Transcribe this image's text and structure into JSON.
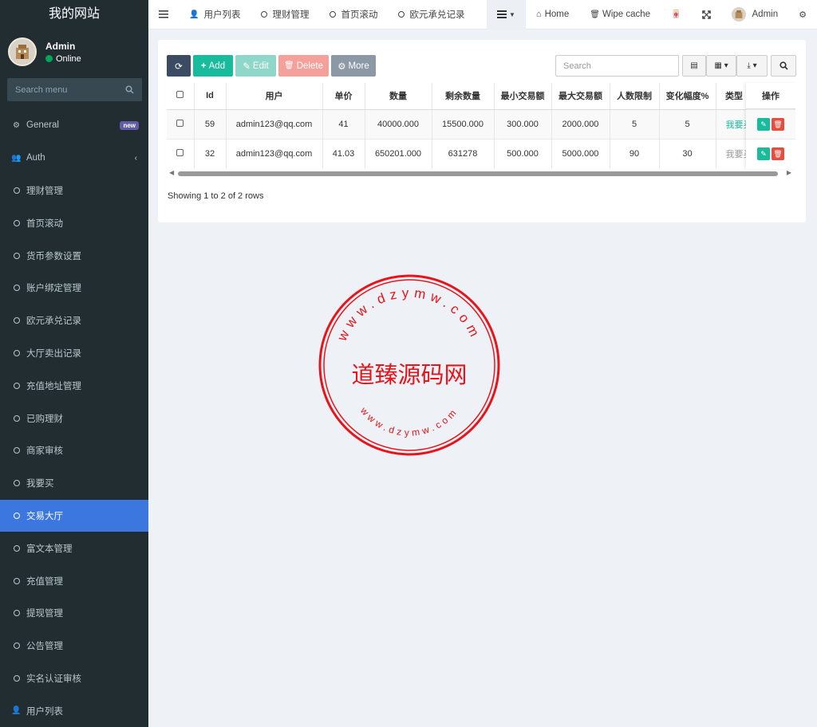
{
  "app": {
    "logo": "我的网站"
  },
  "user": {
    "name": "Admin",
    "status": "Online"
  },
  "sidebar": {
    "search_placeholder": "Search menu",
    "items": [
      {
        "label": "General",
        "icon": "gears-icon",
        "badge": "new"
      },
      {
        "label": "Auth",
        "icon": "users-icon",
        "chevron": "‹"
      },
      {
        "label": "理财管理",
        "icon": "circle-icon"
      },
      {
        "label": "首页滚动",
        "icon": "circle-icon"
      },
      {
        "label": "货币参数设置",
        "icon": "circle-icon"
      },
      {
        "label": "账户绑定管理",
        "icon": "circle-icon"
      },
      {
        "label": "欧元承兑记录",
        "icon": "circle-icon"
      },
      {
        "label": "大厅卖出记录",
        "icon": "circle-icon"
      },
      {
        "label": "充值地址管理",
        "icon": "circle-icon"
      },
      {
        "label": "已购理财",
        "icon": "circle-icon"
      },
      {
        "label": "商家审核",
        "icon": "circle-icon"
      },
      {
        "label": "我要买",
        "icon": "circle-icon"
      },
      {
        "label": "交易大厅",
        "icon": "circle-icon",
        "active": true
      },
      {
        "label": "富文本管理",
        "icon": "circle-icon"
      },
      {
        "label": "充值管理",
        "icon": "circle-icon"
      },
      {
        "label": "提现管理",
        "icon": "circle-icon"
      },
      {
        "label": "公告管理",
        "icon": "circle-icon"
      },
      {
        "label": "实名认证审核",
        "icon": "circle-icon"
      },
      {
        "label": "用户列表",
        "icon": "user-icon"
      }
    ]
  },
  "topbar": {
    "tabs": [
      "用户列表",
      "理财管理",
      "首页滚动",
      "欧元承兑记录"
    ],
    "home": "Home",
    "wipe_cache": "Wipe cache",
    "admin": "Admin"
  },
  "toolbar": {
    "add": "Add",
    "edit": "Edit",
    "delete": "Delete",
    "more": "More",
    "search_placeholder": "Search"
  },
  "table": {
    "headers": [
      "Id",
      "用户",
      "单价",
      "数量",
      "剩余数量",
      "最小交易额",
      "最大交易额",
      "人数限制",
      "变化幅度%",
      "类型",
      "操作"
    ],
    "rows": [
      {
        "id": "59",
        "user": "admin123@qq.com",
        "price": "41",
        "qty": "40000.000",
        "remain": "15500.000",
        "min": "300.000",
        "max": "2000.000",
        "limit": "5",
        "change": "5",
        "type": "我要买"
      },
      {
        "id": "32",
        "user": "admin123@qq.com",
        "price": "41.03",
        "qty": "650201.000",
        "remain": "631278",
        "min": "500.000",
        "max": "5000.000",
        "limit": "90",
        "change": "30",
        "type": "我要买"
      }
    ]
  },
  "footer": {
    "showing": "Showing 1 to 2 of 2 rows"
  },
  "watermark": {
    "text": "道臻源码网",
    "ring_top": "www.dzymw.com",
    "ring_bottom": "www.dzymw.com"
  },
  "colors": {
    "sidebar_bg": "#222d32",
    "active": "#3c77e0",
    "add": "#18bc9c",
    "delete": "#e74c3c",
    "stamp": "#e8141b"
  }
}
